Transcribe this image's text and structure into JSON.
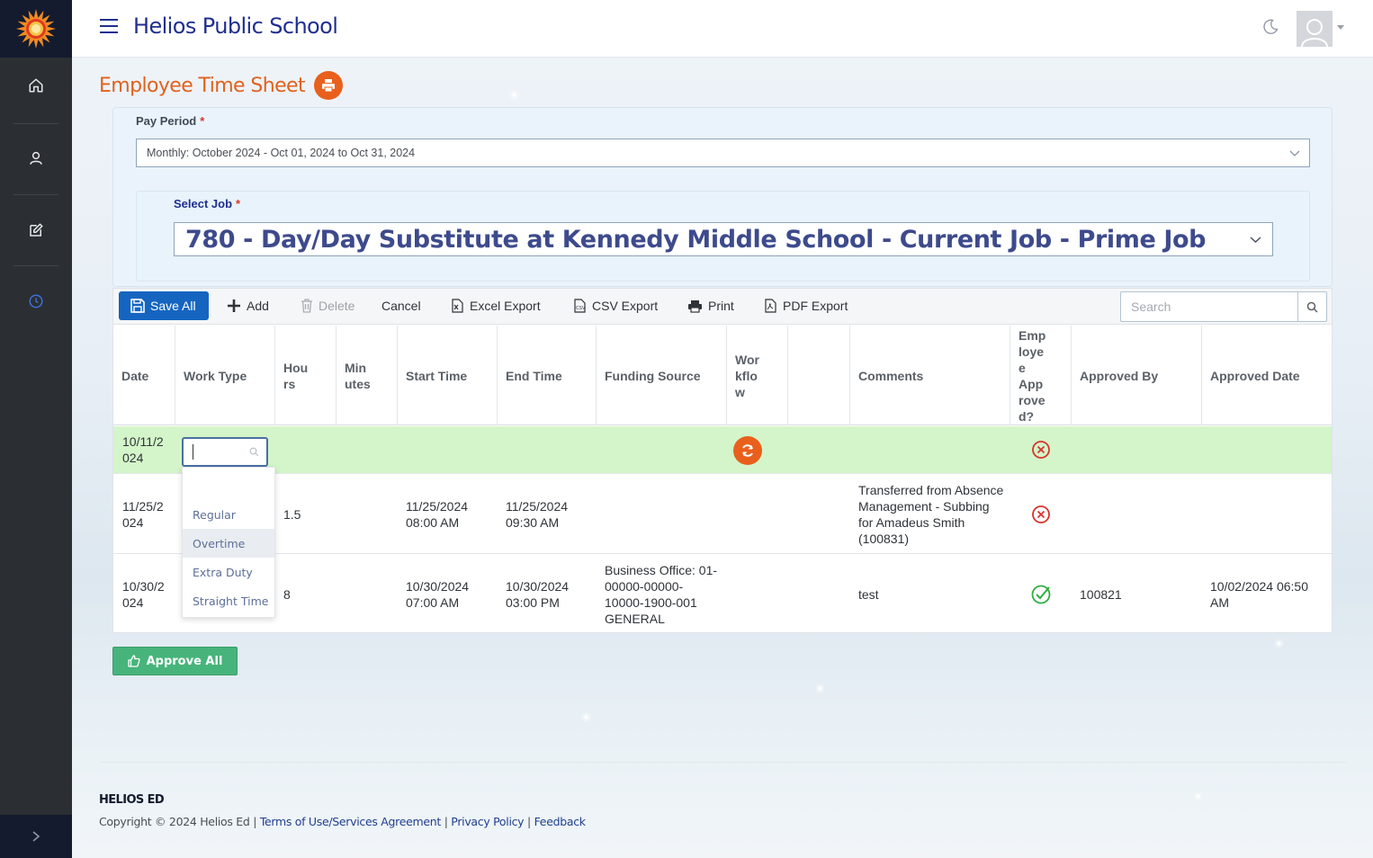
{
  "header": {
    "school_name": "Helios Public School"
  },
  "sidebar": {
    "items": [
      {
        "icon": "home-icon"
      },
      {
        "icon": "user-icon"
      },
      {
        "icon": "edit-icon"
      },
      {
        "icon": "clock-icon"
      }
    ]
  },
  "page": {
    "title": "Employee Time Sheet"
  },
  "pay_period": {
    "label": "Pay Period",
    "required_mark": "*",
    "value": "Monthly: October 2024 - Oct 01, 2024 to Oct 31, 2024"
  },
  "job": {
    "label": "Select Job",
    "required_mark": "*",
    "value": "780 - Day/Day Substitute at Kennedy Middle School - Current Job - Prime Job"
  },
  "toolbar": {
    "save_all": "Save All",
    "add": "Add",
    "delete": "Delete",
    "cancel": "Cancel",
    "excel_export": "Excel Export",
    "csv_export": "CSV Export",
    "print": "Print",
    "pdf_export": "PDF Export",
    "search_placeholder": "Search"
  },
  "table": {
    "headers": {
      "date": "Date",
      "work_type": "Work Type",
      "hours": [
        "Hou",
        "rs"
      ],
      "minutes": [
        "Min",
        "utes"
      ],
      "start_time": "Start Time",
      "end_time": "End Time",
      "funding_source": "Funding Source",
      "workflow": [
        "Wor",
        "kflo",
        "w"
      ],
      "blank": "",
      "comments": "Comments",
      "employee_approved": [
        "Emp",
        "loye",
        "e",
        "App",
        "rove",
        "d?"
      ],
      "approved_by": "Approved By",
      "approved_date": "Approved Date"
    },
    "rows": [
      {
        "date": [
          "10/11/2",
          "024"
        ],
        "work_type": "",
        "hours": "",
        "minutes": "",
        "start_time": [
          "",
          ""
        ],
        "end_time": [
          "",
          ""
        ],
        "funding_source": [
          "",
          "",
          "",
          ""
        ],
        "comments": [
          "",
          "",
          "",
          ""
        ],
        "employee_approved": "not-approved",
        "approved_by": "",
        "approved_date": [
          "",
          ""
        ]
      },
      {
        "date": [
          "11/25/2",
          "024"
        ],
        "work_type": "",
        "hours": "1.5",
        "minutes": "",
        "start_time": [
          "11/25/2024",
          "08:00 AM"
        ],
        "end_time": [
          "11/25/2024",
          "09:30 AM"
        ],
        "funding_source": [
          "",
          "",
          "",
          ""
        ],
        "comments": [
          "Transferred from Absence",
          "Management - Subbing",
          "for Amadeus Smith",
          "(100831)"
        ],
        "employee_approved": "not-approved",
        "approved_by": "",
        "approved_date": [
          "",
          ""
        ]
      },
      {
        "date": [
          "10/30/2",
          "024"
        ],
        "work_type": "",
        "hours": "8",
        "minutes": "",
        "start_time": [
          "10/30/2024",
          "07:00 AM"
        ],
        "end_time": [
          "10/30/2024",
          "03:00 PM"
        ],
        "funding_source": [
          "Business Office: 01-",
          "00000-00000-",
          "10000-1900-001",
          "GENERAL"
        ],
        "comments": [
          "test",
          "",
          "",
          ""
        ],
        "employee_approved": "approved",
        "approved_by": "100821",
        "approved_date": [
          "10/02/2024 06:50",
          "AM"
        ]
      }
    ]
  },
  "work_type_dropdown": {
    "options": [
      "",
      "Regular",
      "Overtime",
      "Extra Duty",
      "Straight Time"
    ],
    "highlighted": "Overtime"
  },
  "actions": {
    "approve_all": "Approve All"
  },
  "footer": {
    "brand": "HELIOS ED",
    "copyright": "Copyright © 2024 Helios Ed",
    "sep": "|",
    "terms": "Terms of Use/Services Agreement",
    "privacy": "Privacy Policy",
    "feedback": "Feedback"
  },
  "colors": {
    "accent_orange": "#e8601c",
    "title_orange": "#e0621d",
    "primary_blue": "#1565c0",
    "school_name": "#1f2f8f",
    "edit_row_green": "#d3f5c9",
    "approve_green": "#47b47b",
    "reject_red": "#d9342b",
    "approved_check": "#2fae3f"
  }
}
